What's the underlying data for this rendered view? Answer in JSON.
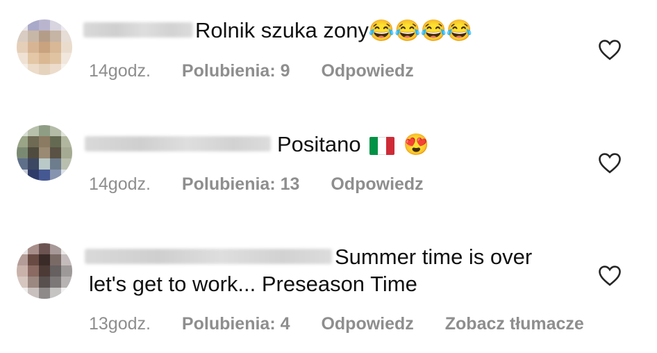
{
  "comments": [
    {
      "text": "Rolnik szuka zony",
      "emojis": "😂😂😂😂",
      "time": "14godz.",
      "likes": "Polubienia: 9",
      "reply": "Odpowiedz"
    },
    {
      "text": "Positano",
      "emojis": "😍",
      "time": "14godz.",
      "likes": "Polubienia: 13",
      "reply": "Odpowiedz"
    },
    {
      "text_line1": "Summer time is over",
      "text_line2": "let's get to work... Preseason Time",
      "time": "13godz.",
      "likes": "Polubienia: 4",
      "reply": "Odpowiedz",
      "translate": "Zobacz tłumacze"
    }
  ],
  "colors": {
    "meta_gray": "#8e8e8e",
    "flag_green": "#009246",
    "flag_white": "#ffffff",
    "flag_red": "#ce2b37"
  }
}
